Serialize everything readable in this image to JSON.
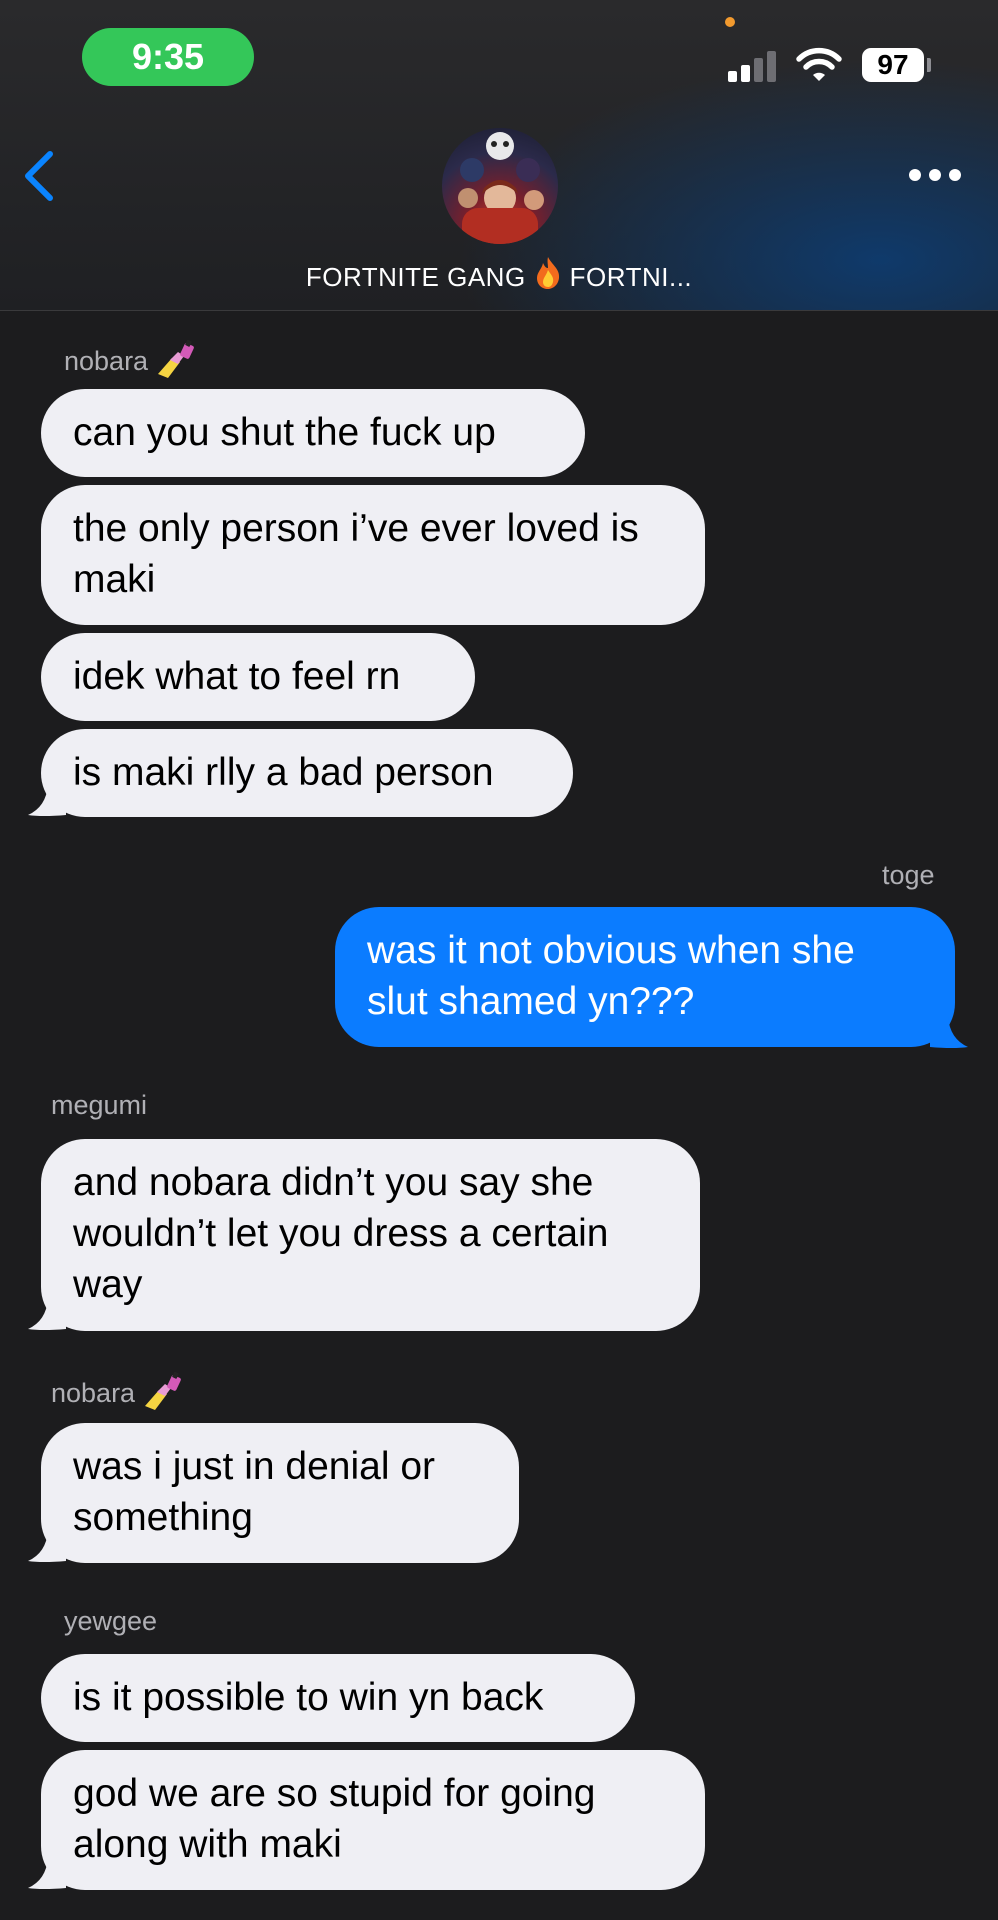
{
  "status_bar": {
    "time": "9:35",
    "battery": "97"
  },
  "header": {
    "group_name_left": "FORTNITE GANG",
    "group_name_right": "FORTNI..."
  },
  "messages": [
    {
      "sender": "nobara",
      "texts": [
        "can you shut the fuck up",
        "the only person i’ve ever loved is maki",
        "idek what to feel rn",
        "is maki rlly a bad person"
      ]
    },
    {
      "sender": "toge",
      "texts": [
        "was it not obvious when she slut shamed yn???"
      ]
    },
    {
      "sender": "megumi",
      "texts": [
        "and nobara didn’t you say she wouldn’t let you dress a certain way"
      ]
    },
    {
      "sender": "nobara",
      "texts": [
        "was i just in denial or something"
      ]
    },
    {
      "sender": "yewgee",
      "texts": [
        "is it possible to win yn back",
        "god we are so stupid for going along with maki"
      ]
    }
  ],
  "icons": [
    "back-chevron-icon",
    "more-options-icon",
    "signal-icon",
    "wifi-icon",
    "battery-icon",
    "fire-emoji-icon",
    "nail-polish-emoji-icon"
  ],
  "colors": {
    "background": "#1c1c1e",
    "incoming_bubble": "#efeff4",
    "outgoing_bubble": "#0b7cff",
    "accent_blue": "#0a84ff",
    "time_pill": "#34c759"
  }
}
